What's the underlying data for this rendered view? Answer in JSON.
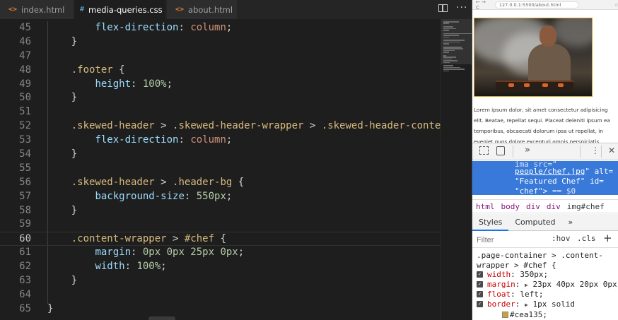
{
  "editor": {
    "tabs": [
      {
        "icon": "<>",
        "label": "index.html",
        "active": false
      },
      {
        "icon": "#",
        "label": "media-queries.css",
        "active": true,
        "close": "×"
      },
      {
        "icon": "<>",
        "label": "about.html",
        "active": false
      }
    ],
    "lines": [
      {
        "n": "45",
        "tokens": [
          [
            "p",
            "        "
          ],
          [
            "prop",
            "flex-direction"
          ],
          [
            "p",
            ": "
          ],
          [
            "val",
            "column"
          ],
          [
            "p",
            ";"
          ]
        ]
      },
      {
        "n": "46",
        "tokens": [
          [
            "p",
            "    }"
          ]
        ]
      },
      {
        "n": "47",
        "tokens": []
      },
      {
        "n": "48",
        "tokens": [
          [
            "p",
            "    "
          ],
          [
            "sel",
            ".footer"
          ],
          [
            "p",
            " {"
          ]
        ]
      },
      {
        "n": "49",
        "tokens": [
          [
            "p",
            "        "
          ],
          [
            "prop",
            "height"
          ],
          [
            "p",
            ": "
          ],
          [
            "num",
            "100%"
          ],
          [
            "p",
            ";"
          ]
        ]
      },
      {
        "n": "50",
        "tokens": [
          [
            "p",
            "    }"
          ]
        ]
      },
      {
        "n": "51",
        "tokens": []
      },
      {
        "n": "52",
        "tokens": [
          [
            "p",
            "    "
          ],
          [
            "sel",
            ".skewed-header"
          ],
          [
            "p",
            " > "
          ],
          [
            "sel",
            ".skewed-header-wrapper"
          ],
          [
            "p",
            " > "
          ],
          [
            "sel",
            ".skewed-header-content"
          ]
        ]
      },
      {
        "n": "53",
        "tokens": [
          [
            "p",
            "        "
          ],
          [
            "prop",
            "flex-direction"
          ],
          [
            "p",
            ": "
          ],
          [
            "val",
            "column"
          ],
          [
            "p",
            ";"
          ]
        ]
      },
      {
        "n": "54",
        "tokens": [
          [
            "p",
            "    }"
          ]
        ]
      },
      {
        "n": "55",
        "tokens": []
      },
      {
        "n": "56",
        "tokens": [
          [
            "p",
            "    "
          ],
          [
            "sel",
            ".skewed-header"
          ],
          [
            "p",
            " > "
          ],
          [
            "sel",
            ".header-bg"
          ],
          [
            "p",
            " {"
          ]
        ]
      },
      {
        "n": "57",
        "tokens": [
          [
            "p",
            "        "
          ],
          [
            "prop",
            "background-size"
          ],
          [
            "p",
            ": "
          ],
          [
            "num",
            "550px"
          ],
          [
            "p",
            ";"
          ]
        ]
      },
      {
        "n": "58",
        "tokens": [
          [
            "p",
            "    }"
          ]
        ]
      },
      {
        "n": "59",
        "tokens": []
      },
      {
        "n": "60",
        "current": true,
        "tokens": [
          [
            "p",
            "    "
          ],
          [
            "sel",
            ".content-wrapper"
          ],
          [
            "p",
            " > "
          ],
          [
            "sel",
            "#chef"
          ],
          [
            "p",
            " {"
          ]
        ]
      },
      {
        "n": "61",
        "tokens": [
          [
            "p",
            "        "
          ],
          [
            "prop",
            "margin"
          ],
          [
            "p",
            ": "
          ],
          [
            "num",
            "0px 0px 25px 0px"
          ],
          [
            "p",
            ";"
          ]
        ]
      },
      {
        "n": "62",
        "tokens": [
          [
            "p",
            "        "
          ],
          [
            "prop",
            "width"
          ],
          [
            "p",
            ": "
          ],
          [
            "num",
            "100%"
          ],
          [
            "p",
            ";"
          ]
        ]
      },
      {
        "n": "63",
        "tokens": [
          [
            "p",
            "    }"
          ]
        ]
      },
      {
        "n": "64",
        "tokens": []
      },
      {
        "n": "65",
        "tokens": [
          [
            "p",
            "}"
          ]
        ]
      }
    ]
  },
  "browser": {
    "nav_glyphs": "← →  C",
    "url": "127.0.0.1:5500/about.html",
    "star": "☆",
    "page_text": "Lorem ipsum dolor, sit amet consectetur adipisicing elit. Beatae, repellat sequi. Placeat deleniti ipsum ea temporibus, obcaecati dolorum ipsa ut repellat, in eveniet quos dolore excepturi omnis perspiciatis."
  },
  "devtools": {
    "more_glyph": "»",
    "kebab_glyph": "⋮",
    "close_glyph": "✕",
    "selected_node": {
      "line1": "ima",
      "line1b": "src=\"",
      "line2": "people/chef.jpg",
      "line2b": "\" alt=",
      "line3": "\"Featured Chef\" id=",
      "line4": "\"chef\">",
      "line4b": " == $0"
    },
    "breadcrumbs": [
      "html",
      "body",
      "div",
      "div",
      "img#chef"
    ],
    "panel_tabs": [
      "Styles",
      "Computed",
      "»"
    ],
    "filter_placeholder": "Filter",
    "hov": ":hov",
    "cls": ".cls",
    "plus": "+",
    "rule_selector_1": ".page-container > .content-",
    "rule_selector_2": "wrapper > #chef {",
    "declarations": [
      {
        "name": "width",
        "value": "350px;"
      },
      {
        "name": "margin",
        "tri": "▶",
        "value": "23px 40px 20px 0px;"
      },
      {
        "name": "float",
        "value": "left;"
      },
      {
        "name": "border",
        "tri": "▶",
        "value": "1px solid"
      }
    ],
    "border_color": "#cea135;",
    "accent_blue": "#3879d9"
  }
}
